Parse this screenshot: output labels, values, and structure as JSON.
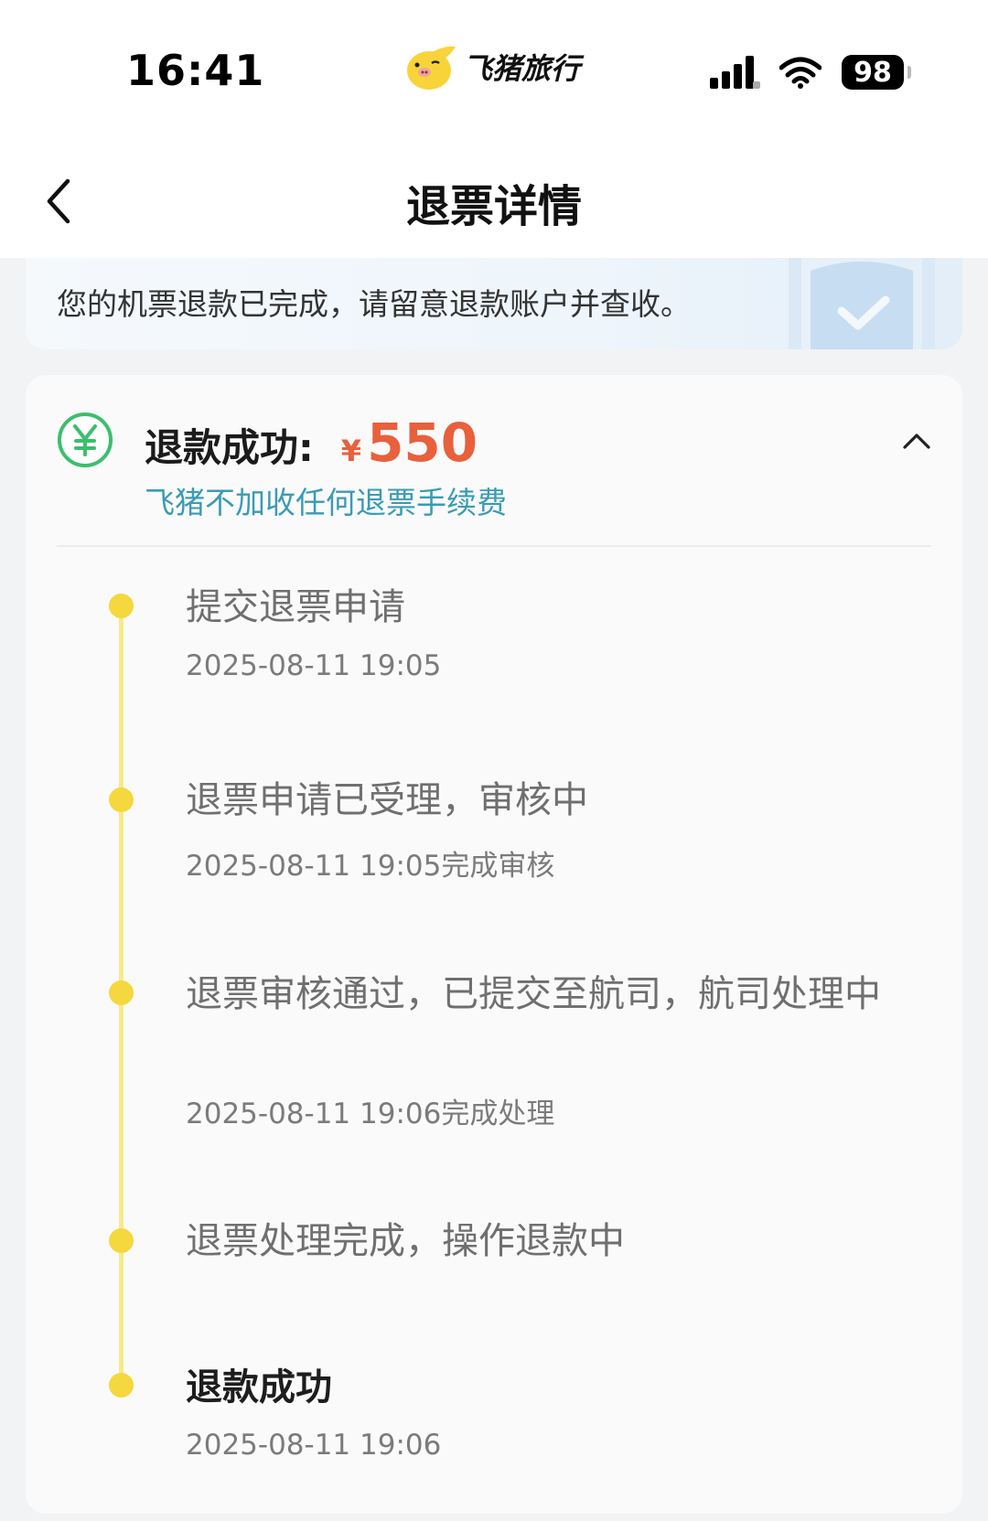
{
  "status_bar": {
    "time": "16:41",
    "brand_name": "飞猪旅行",
    "battery": "98",
    "icons": [
      "signal-icon",
      "wifi-icon",
      "battery-icon"
    ]
  },
  "nav": {
    "title": "退票详情",
    "back_icon": "back-chevron-icon"
  },
  "notice": {
    "text": "您的机票退款已完成，请留意退款账户并查收。",
    "icon": "shield-check-icon"
  },
  "refund": {
    "status_label": "退款成功:",
    "currency": "¥",
    "amount": "550",
    "fee_note": "飞猪不加收任何退票手续费",
    "icon": "yuan-icon",
    "collapse_icon": "chevron-up-icon",
    "colors": {
      "amount": "#e8603c",
      "note": "#3a9bb4",
      "dot": "#f4d83e",
      "line": "#f8e98a"
    }
  },
  "timeline": [
    {
      "title": "提交退票申请",
      "time": "2025-08-11 19:05"
    },
    {
      "title": "退票申请已受理，审核中",
      "time": "2025-08-11 19:05完成审核"
    },
    {
      "title": "退票审核通过，已提交至航司，航司处理中",
      "time": "2025-08-11 19:06完成处理"
    },
    {
      "title": "退票处理完成，操作退款中",
      "time": ""
    },
    {
      "title": "退款成功",
      "time": "2025-08-11 19:06"
    }
  ]
}
